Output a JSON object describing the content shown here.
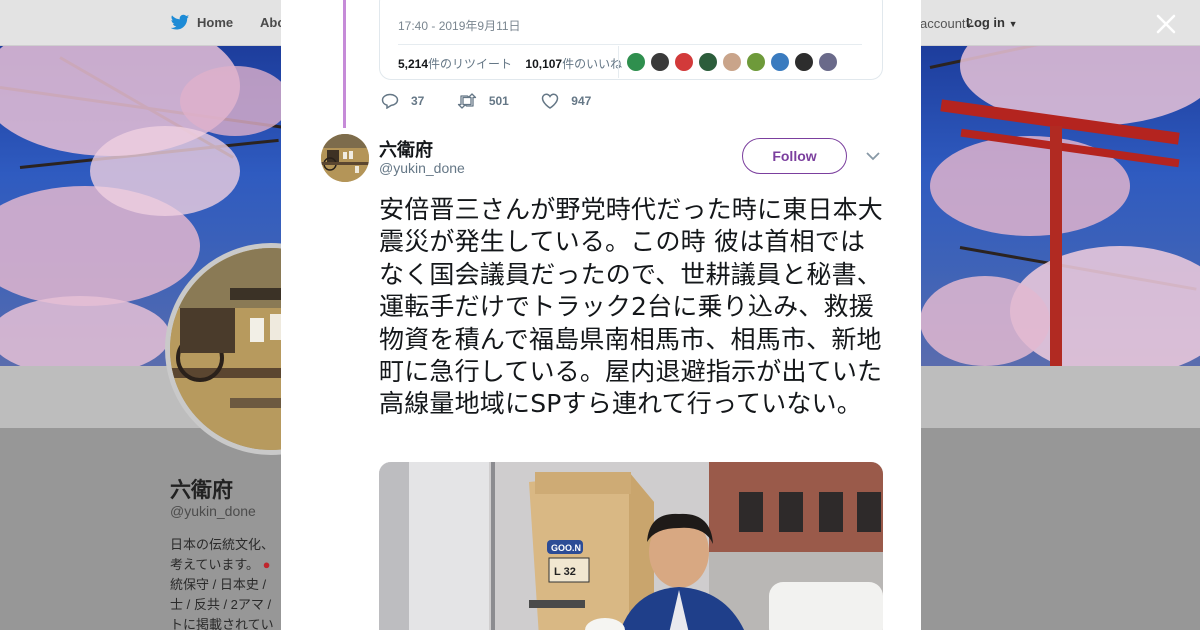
{
  "nav": {
    "home_label": "Home",
    "about_label": "Abo",
    "account_question": "account?",
    "login_label": "Log in"
  },
  "profile": {
    "name": "六衛府",
    "handle": "@yukin_done",
    "bio_lines": [
      "日本の伝統文化、",
      "考えています。",
      "統保守 / 日本史 / ",
      "士 / 反共 / 2アマ / ",
      "トに掲載されてい"
    ]
  },
  "quoted_tweet": {
    "timestamp": "17:40 - 2019年9月11日",
    "retweets_count": "5,214",
    "retweets_label": "件のリツイート",
    "likes_count": "10,107",
    "likes_label": "件のいいね",
    "liker_colors": [
      "#2f8f4e",
      "#3a3a3a",
      "#d23a3a",
      "#2c5d3b",
      "#c9a48a",
      "#6e9a3a",
      "#3a7bbf",
      "#2d2d2d",
      "#6a6a8a"
    ]
  },
  "quoted_actions": {
    "replies": "37",
    "retweets": "501",
    "likes": "947"
  },
  "tweet": {
    "author_name": "六衛府",
    "author_handle": "@yukin_done",
    "follow_label": "Follow",
    "text": "安倍晋三さんが野党時代だった時に東日本大震災が発生している。この時 彼は首相ではなく国会議員だったので、世耕議員と秘書、運転手だけでトラック2台に乗り込み、救援物資を積んで福島県南相馬市、相馬市、新地町に急行している。屋内退避指示が出ていた高線量地域にSPすら連れて行っていない。"
  },
  "photo": {
    "box_brand": "GOO.N",
    "box_size": "L 32"
  },
  "colors": {
    "accent": "#7b3f9e",
    "thread_line": "#c68bd8",
    "muted_text": "#657786"
  }
}
